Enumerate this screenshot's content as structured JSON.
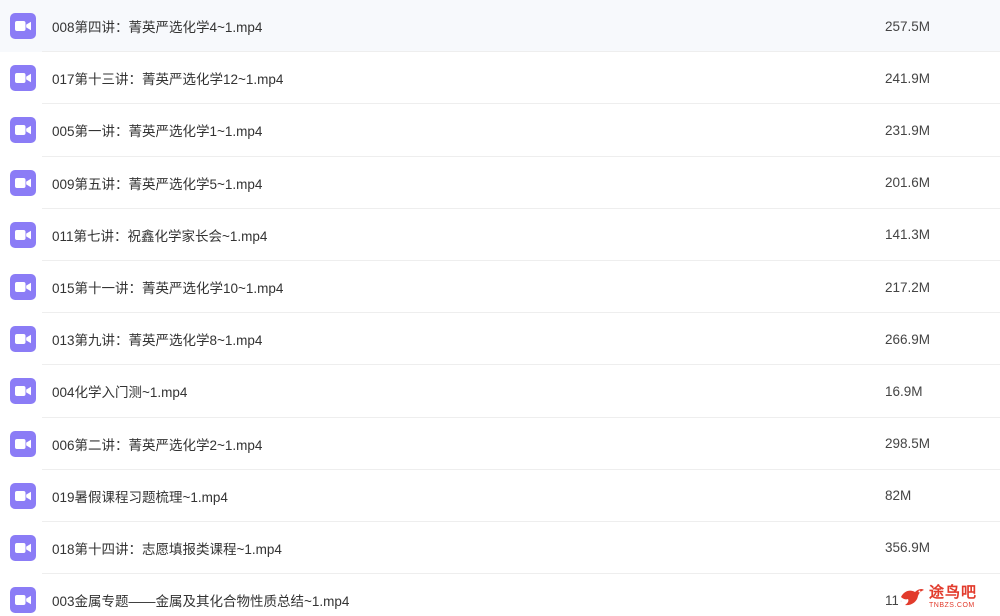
{
  "icons": {
    "file": "video-file-icon"
  },
  "colors": {
    "icon_bg": "#8b7cf6",
    "watermark": "#e23b2c"
  },
  "files": [
    {
      "name": "008第四讲：菁英严选化学4~1.mp4",
      "size": "257.5M"
    },
    {
      "name": "017第十三讲：菁英严选化学12~1.mp4",
      "size": "241.9M"
    },
    {
      "name": "005第一讲：菁英严选化学1~1.mp4",
      "size": "231.9M"
    },
    {
      "name": "009第五讲：菁英严选化学5~1.mp4",
      "size": "201.6M"
    },
    {
      "name": "011第七讲：祝鑫化学家长会~1.mp4",
      "size": "141.3M"
    },
    {
      "name": "015第十一讲：菁英严选化学10~1.mp4",
      "size": "217.2M"
    },
    {
      "name": "013第九讲：菁英严选化学8~1.mp4",
      "size": "266.9M"
    },
    {
      "name": "004化学入门测~1.mp4",
      "size": "16.9M"
    },
    {
      "name": "006第二讲：菁英严选化学2~1.mp4",
      "size": "298.5M"
    },
    {
      "name": "019暑假课程习题梳理~1.mp4",
      "size": "82M"
    },
    {
      "name": "018第十四讲：志愿填报类课程~1.mp4",
      "size": "356.9M"
    },
    {
      "name": "003金属专题——金属及其化合物性质总结~1.mp4",
      "size": "11·"
    }
  ],
  "watermark": {
    "title": "途鸟吧",
    "subtitle": "TNBZS.COM"
  }
}
